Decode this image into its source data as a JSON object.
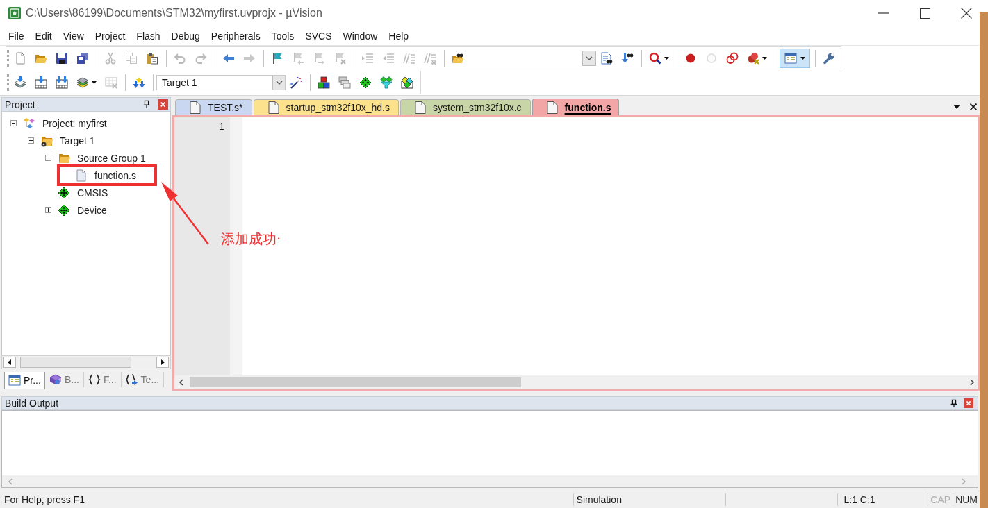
{
  "window": {
    "title": "C:\\Users\\86199\\Documents\\STM32\\myfirst.uvprojx - µVision"
  },
  "menu": [
    "File",
    "Edit",
    "View",
    "Project",
    "Flash",
    "Debug",
    "Peripherals",
    "Tools",
    "SVCS",
    "Window",
    "Help"
  ],
  "toolbar_1": {
    "groups": [
      [
        {
          "disabled": false
        },
        {
          "disabled": false
        },
        {
          "disabled": false
        },
        {
          "disabled": false
        }
      ],
      [
        {
          "disabled": true
        },
        {
          "disabled": true
        },
        {
          "disabled": false
        }
      ],
      [
        {
          "disabled": true
        },
        {
          "disabled": true
        }
      ],
      [
        {
          "disabled": false
        },
        {
          "disabled": true
        }
      ],
      [
        {
          "disabled": false
        },
        {
          "disabled": true
        },
        {
          "disabled": true
        },
        {
          "disabled": true
        }
      ],
      [
        {
          "disabled": true
        },
        {
          "disabled": true
        },
        {
          "disabled": true
        },
        {
          "disabled": true
        }
      ],
      [
        {
          "disabled": false
        }
      ],
      [
        {
          "disabled": false
        },
        {
          "disabled": false
        }
      ],
      [
        {
          "disabled": false
        }
      ],
      [
        {
          "disabled": false
        },
        {
          "disabled": true
        },
        {
          "disabled": false
        },
        {
          "disabled": false
        }
      ],
      [
        {
          "disabled": false,
          "pressed": true
        }
      ],
      [
        {
          "disabled": false
        }
      ]
    ]
  },
  "toolbar_2": {
    "groups_before": [
      [
        {
          "disabled": false
        },
        {
          "disabled": false
        },
        {
          "disabled": false
        },
        {
          "disabled": false
        },
        {
          "disabled": true
        }
      ],
      [
        {
          "disabled": false
        }
      ]
    ],
    "target": "Target 1",
    "groups_after": [
      [
        {
          "disabled": false
        }
      ],
      [
        {
          "disabled": false
        },
        {
          "disabled": false
        },
        {
          "disabled": false
        },
        {
          "disabled": false
        },
        {
          "disabled": false
        }
      ]
    ]
  },
  "project_panel": {
    "title": "Project",
    "tree": [
      {
        "label": "Project: myfirst",
        "kind": "project",
        "expanded": true,
        "children": [
          {
            "label": "Target 1",
            "kind": "target",
            "expanded": true,
            "children": [
              {
                "label": "Source Group 1",
                "kind": "group",
                "expanded": true,
                "children": [
                  {
                    "label": "function.s",
                    "kind": "file"
                  }
                ]
              },
              {
                "label": "CMSIS",
                "kind": "component"
              },
              {
                "label": "Device",
                "kind": "component",
                "expanded": false
              }
            ]
          }
        ]
      }
    ],
    "tabs": [
      {
        "label": "Pr...",
        "selected": true
      },
      {
        "label": "B...",
        "selected": false
      },
      {
        "label": "F...",
        "selected": false
      },
      {
        "label": "Te...",
        "selected": false
      }
    ]
  },
  "editor": {
    "tabs": [
      {
        "label": "TEST.s*",
        "color": "#c9d7f0",
        "selected": false
      },
      {
        "label": "startup_stm32f10x_hd.s",
        "color": "#fde28e",
        "selected": false
      },
      {
        "label": "system_stm32f10x.c",
        "color": "#c8d5a6",
        "selected": false
      },
      {
        "label": "function.s",
        "color": "#f2a6a6",
        "selected": true
      }
    ],
    "line_numbers": [
      "1"
    ]
  },
  "build_output": {
    "title": "Build Output"
  },
  "status_bar": {
    "help": "For Help, press F1",
    "mode": "Simulation",
    "position": "L:1 C:1",
    "indicators": [
      {
        "label": "CAP",
        "on": false
      },
      {
        "label": "NUM",
        "on": true
      }
    ]
  },
  "annotation": {
    "text": "添加成功·"
  }
}
